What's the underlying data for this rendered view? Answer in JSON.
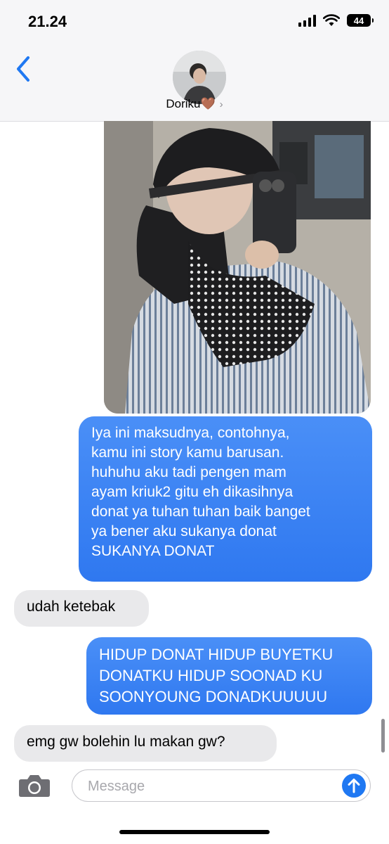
{
  "status": {
    "time": "21.24",
    "battery": "44"
  },
  "header": {
    "contact_name": "Doriku🤎",
    "chevron": "›"
  },
  "messages": [
    {
      "side": "outgoing",
      "lines": [
        "Iya ini maksudnya, contohnya,",
        "kamu ini story kamu barusan.",
        "huhuhu aku tadi pengen mam",
        "ayam kriuk2 gitu eh dikasihnya",
        "donat ya tuhan tuhan baik banget",
        "ya bener aku sukanya donat",
        "SUKANYA DONAT"
      ]
    },
    {
      "side": "incoming",
      "lines": [
        "udah ketebak"
      ]
    },
    {
      "side": "outgoing",
      "lines": [
        "HIDUP DONAT HIDUP BUYETKU",
        "DONATKU HIDUP SOONAD KU",
        "SOONYOUNG DONADKUUUUU"
      ]
    },
    {
      "side": "incoming",
      "lines": [
        "emg gw bolehin lu makan gw?"
      ]
    }
  ],
  "compose": {
    "placeholder": "Message",
    "value": ""
  },
  "colors": {
    "outgoing_bubble": "#3d84f6",
    "incoming_bubble": "#e9e9eb",
    "accent": "#1f78f2"
  },
  "icons": [
    "back-chevron-icon",
    "camera-icon",
    "send-arrow-icon",
    "signal-icon",
    "wifi-icon",
    "battery-icon"
  ]
}
